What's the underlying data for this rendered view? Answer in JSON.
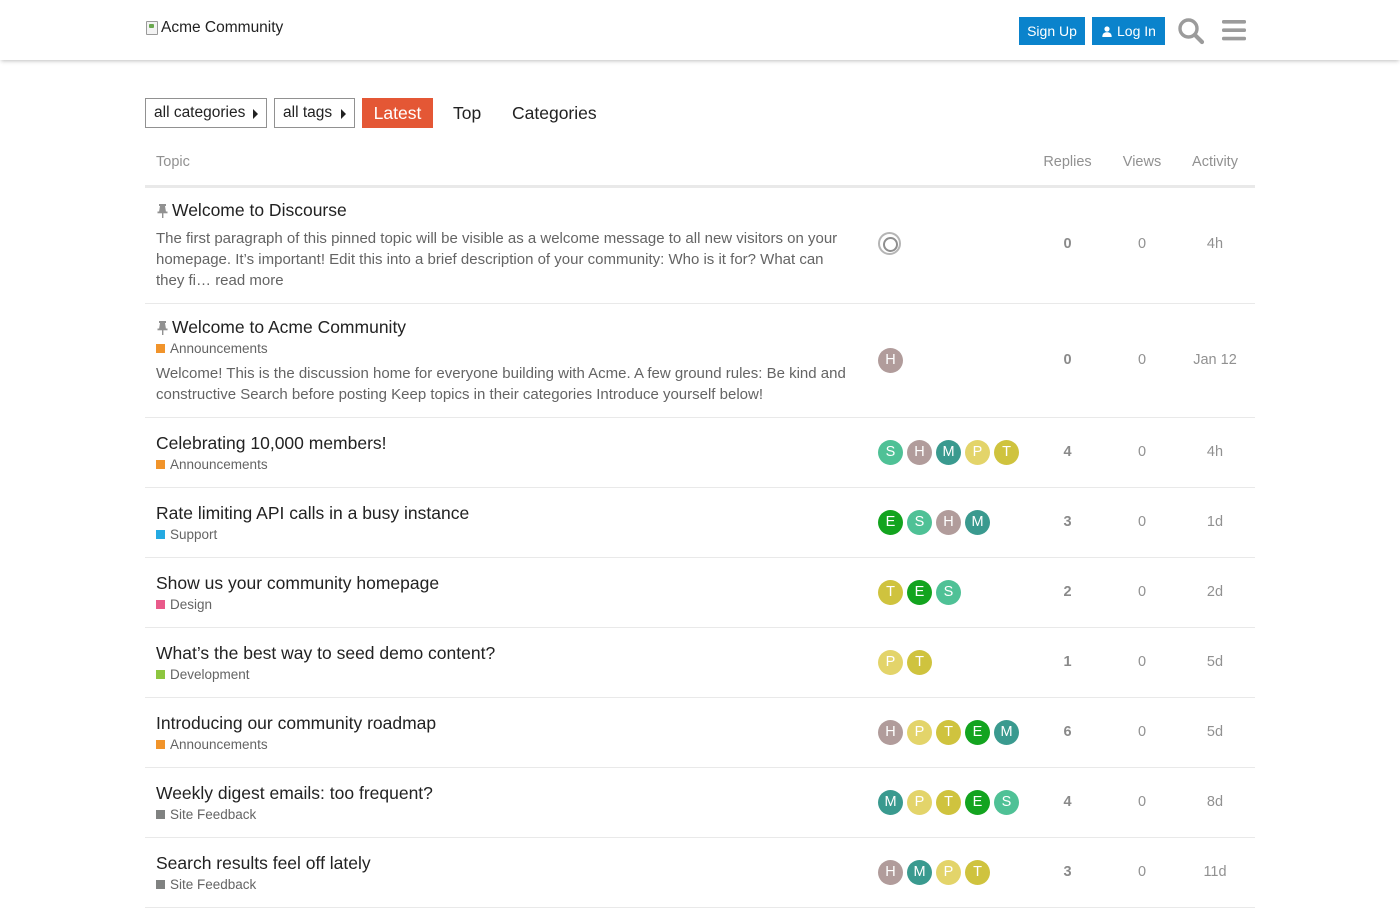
{
  "header": {
    "logo_alt": "Acme Community",
    "signup_label": "Sign Up",
    "login_label": "Log In",
    "accent_color": "#0a83cc"
  },
  "nav": {
    "categories_dropdown": "all categories",
    "tags_dropdown": "all tags",
    "latest": "Latest",
    "top": "Top",
    "categories": "Categories",
    "active_color": "#e45735"
  },
  "list": {
    "col_topic": "Topic",
    "col_replies": "Replies",
    "col_views": "Views",
    "col_activity": "Activity"
  },
  "topics": [
    {
      "title": "Welcome to Discourse",
      "pinned": true,
      "excerpt": "The first paragraph of this pinned topic will be visible as a welcome message to all new visitors on your homepage. It’s important! Edit this into a brief description of your community: Who is it for? What can they fi… ",
      "read_more": "read more",
      "posters": [
        "system"
      ],
      "replies": "0",
      "views": "0",
      "activity": "4h"
    },
    {
      "title": "Welcome to Acme Community",
      "pinned": true,
      "category": "Announcements",
      "category_color": "#F1942B",
      "excerpt": "Welcome! This is the discussion home for everyone building with Acme. A few ground rules: Be kind and constructive Search before posting Keep topics in their categories Introduce yourself below!",
      "posters": [
        "H"
      ],
      "replies": "0",
      "views": "0",
      "activity": "Jan 12"
    },
    {
      "title": "Celebrating 10,000 members!",
      "category": "Announcements",
      "category_color": "#F1942B",
      "posters": [
        "S",
        "H",
        "M",
        "P",
        "T"
      ],
      "replies": "4",
      "views": "0",
      "activity": "4h"
    },
    {
      "title": "Rate limiting API calls in a busy instance",
      "category": "Support",
      "category_color": "#25AAE2",
      "posters": [
        "E",
        "S",
        "H",
        "M"
      ],
      "replies": "3",
      "views": "0",
      "activity": "1d"
    },
    {
      "title": "Show us your community homepage",
      "category": "Design",
      "category_color": "#E95A8A",
      "posters": [
        "T",
        "E",
        "S"
      ],
      "replies": "2",
      "views": "0",
      "activity": "2d"
    },
    {
      "title": "What’s the best way to seed demo content?",
      "category": "Development",
      "category_color": "#8DC63F",
      "posters": [
        "P",
        "T"
      ],
      "replies": "1",
      "views": "0",
      "activity": "5d"
    },
    {
      "title": "Introducing our community roadmap",
      "category": "Announcements",
      "category_color": "#F1942B",
      "posters": [
        "H",
        "P",
        "T",
        "E",
        "M"
      ],
      "replies": "6",
      "views": "0",
      "activity": "5d"
    },
    {
      "title": "Weekly digest emails: too frequent?",
      "category": "Site Feedback",
      "category_color": "#808281",
      "posters": [
        "M",
        "P",
        "T",
        "E",
        "S"
      ],
      "replies": "4",
      "views": "0",
      "activity": "8d"
    },
    {
      "title": "Search results feel off lately",
      "category": "Site Feedback",
      "category_color": "#808281",
      "posters": [
        "H",
        "M",
        "P",
        "T"
      ],
      "replies": "3",
      "views": "0",
      "activity": "11d"
    }
  ],
  "avatar_colors": {
    "S": "#4fc196",
    "H": "#b19c9b",
    "M": "#3a9a8f",
    "P": "#e3d46a",
    "T": "#cfc33e",
    "E": "#13a41f"
  }
}
